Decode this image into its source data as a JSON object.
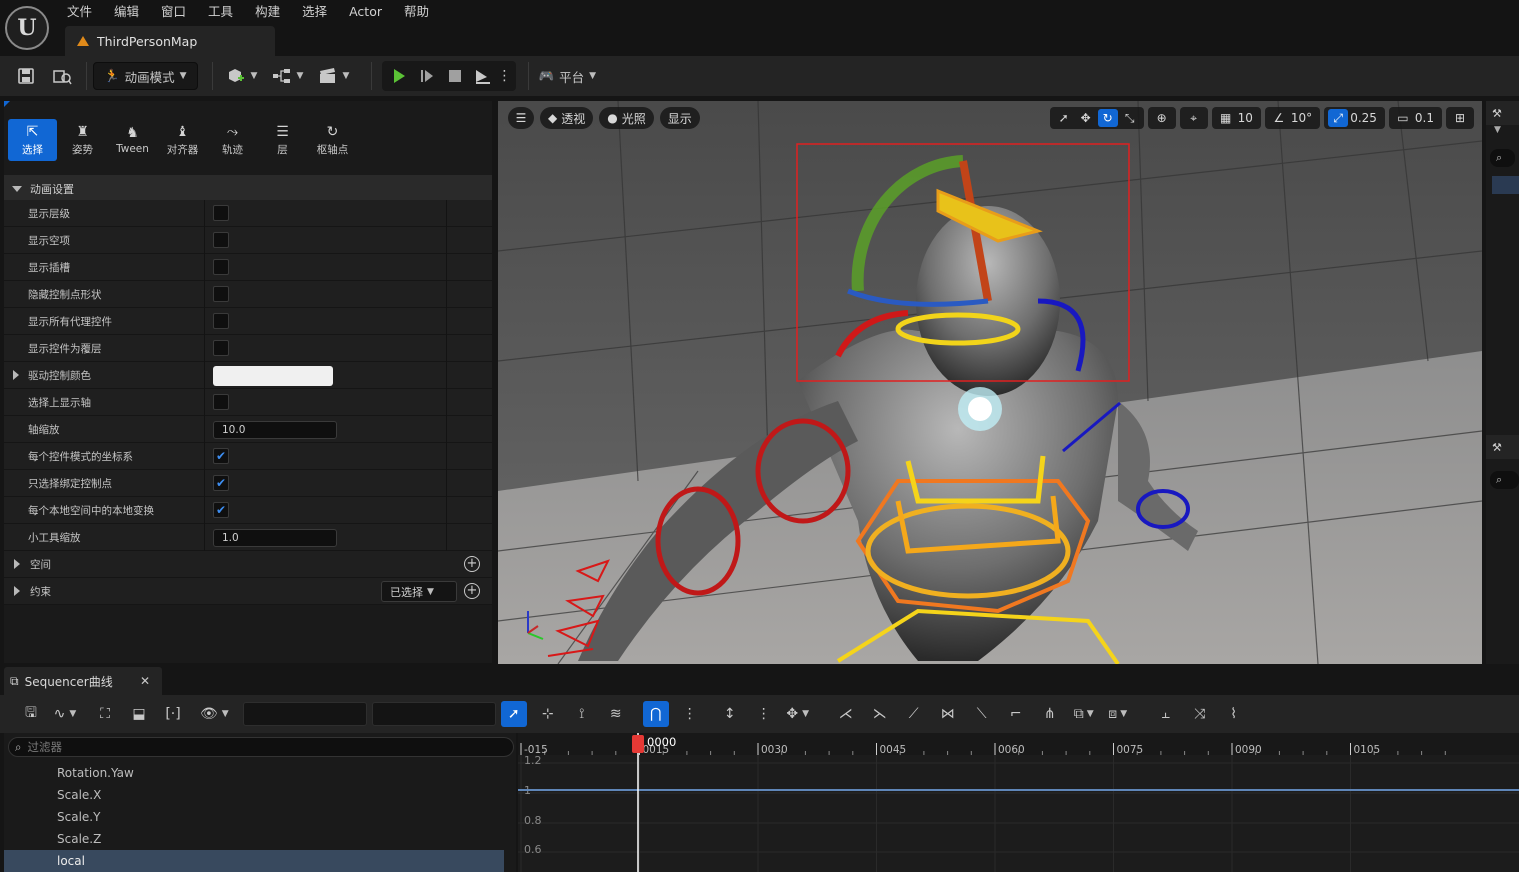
{
  "menu": [
    "文件",
    "编辑",
    "窗口",
    "工具",
    "构建",
    "选择",
    "Actor",
    "帮助"
  ],
  "doc_tab": "ThirdPersonMap",
  "toolbar": {
    "mode_label": "动画模式",
    "platform_label": "平台"
  },
  "tool_tabs": [
    {
      "label": "选择",
      "icon": "⇱"
    },
    {
      "label": "姿势",
      "icon": "♜"
    },
    {
      "label": "Tween",
      "icon": "♞"
    },
    {
      "label": "对齐器",
      "icon": "♝"
    },
    {
      "label": "轨迹",
      "icon": "⤳"
    },
    {
      "label": "层",
      "icon": "☰"
    },
    {
      "label": "枢轴点",
      "icon": "↻"
    }
  ],
  "anim_settings": {
    "header": "动画设置",
    "rows": [
      {
        "label": "显示层级",
        "type": "checkbox",
        "checked": false
      },
      {
        "label": "显示空项",
        "type": "checkbox",
        "checked": false
      },
      {
        "label": "显示插槽",
        "type": "checkbox",
        "checked": false
      },
      {
        "label": "隐藏控制点形状",
        "type": "checkbox",
        "checked": false
      },
      {
        "label": "显示所有代理控件",
        "type": "checkbox",
        "checked": false
      },
      {
        "label": "显示控件为覆层",
        "type": "checkbox",
        "checked": false
      },
      {
        "label": "驱动控制颜色",
        "type": "color",
        "expandable": true
      },
      {
        "label": "选择上显示轴",
        "type": "checkbox",
        "checked": false
      },
      {
        "label": "轴缩放",
        "type": "number",
        "value": "10.0"
      },
      {
        "label": "每个控件模式的坐标系",
        "type": "checkbox",
        "checked": true
      },
      {
        "label": "只选择绑定控制点",
        "type": "checkbox",
        "checked": true
      },
      {
        "label": "每个本地空间中的本地变换",
        "type": "checkbox",
        "checked": true
      },
      {
        "label": "小工具缩放",
        "type": "number",
        "value": "1.0"
      }
    ],
    "space_label": "空间",
    "constraint_label": "约束",
    "constraint_dropdown": "已选择"
  },
  "viewport": {
    "perspective": "透视",
    "lighting": "光照",
    "show": "显示",
    "grid_snap": "10",
    "rot_snap": "10°",
    "scale_snap": "0.25",
    "cam_speed": "0.1"
  },
  "sequencer": {
    "tab_label": "Sequencer曲线",
    "filter_placeholder": "过滤器",
    "tracks": [
      "Rotation.Yaw",
      "Scale.X",
      "Scale.Y",
      "Scale.Z",
      "local"
    ],
    "selected_track_index": 4,
    "timeline": {
      "current_frame": "0000",
      "ticks": [
        "-015",
        "0015",
        "0030",
        "0045",
        "0060",
        "0075",
        "0090",
        "0105"
      ],
      "y_labels": [
        "1.2",
        "1",
        "0.8",
        "0.6"
      ]
    }
  },
  "colors": {
    "accent": "#1167d4",
    "playhead": "#e53935",
    "play_green": "#5bc236"
  }
}
